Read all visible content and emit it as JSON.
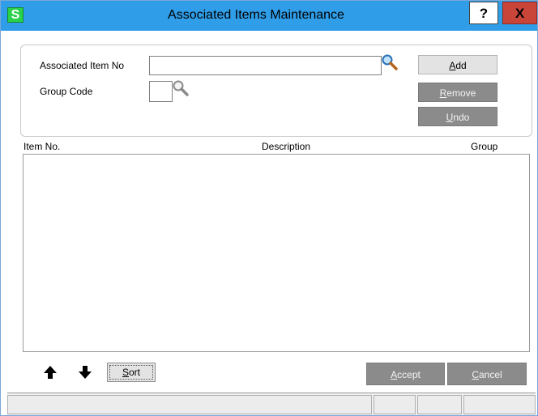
{
  "window": {
    "title": "Associated Items Maintenance",
    "app_icon_letter": "S",
    "help_label": "?",
    "close_label": "X"
  },
  "form": {
    "item_no_label": "Associated Item No",
    "item_no_value": "",
    "group_code_label": "Group Code",
    "group_code_value": ""
  },
  "actions": {
    "add_hotkey": "A",
    "add_rest": "dd",
    "remove_hotkey": "R",
    "remove_rest": "emove",
    "undo_hotkey": "U",
    "undo_rest": "ndo"
  },
  "grid": {
    "columns": [
      "Item No.",
      "Description",
      "Group"
    ],
    "rows": []
  },
  "footer": {
    "sort_hotkey": "S",
    "sort_rest": "ort",
    "accept_hotkey": "A",
    "accept_rest": "ccept",
    "cancel_hotkey": "C",
    "cancel_rest": "ancel"
  },
  "statusbar": {
    "main": "",
    "cell1": "",
    "cell2": "",
    "cell3": ""
  },
  "icons": {
    "lookup": "magnifier-icon",
    "move_up": "arrow-up-icon",
    "move_down": "arrow-down-icon"
  },
  "colors": {
    "titlebar": "#2f9de8",
    "close": "#c9453a",
    "app_icon": "#2ad14a",
    "disabled_button": "#8b8b8b",
    "enabled_button": "#e3e3e3"
  }
}
